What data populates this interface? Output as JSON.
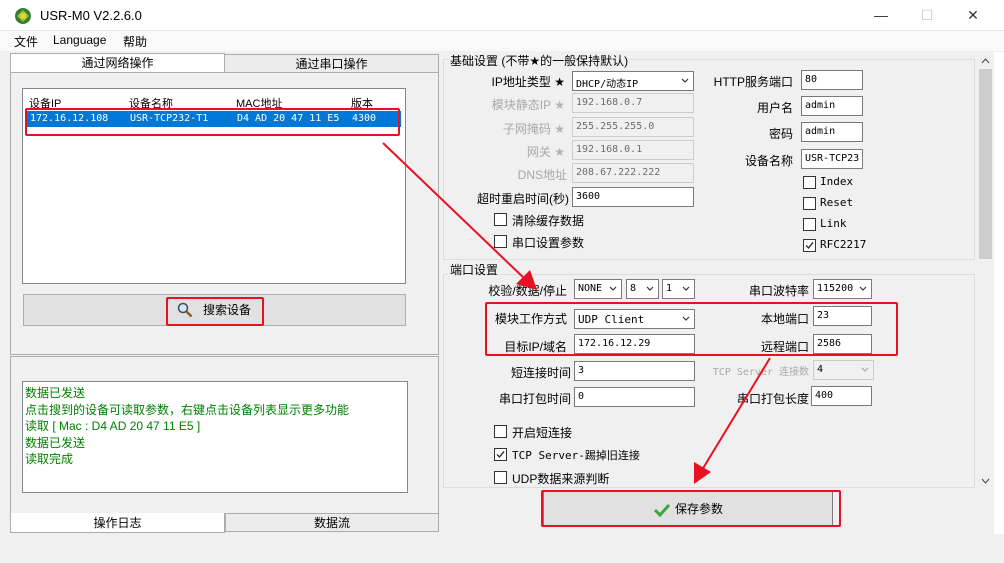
{
  "window": {
    "title": "USR-M0 V2.2.6.0",
    "minimize": "—",
    "maximize": "☐",
    "close": "✕"
  },
  "menu": [
    "文件",
    "Language",
    "帮助"
  ],
  "left_tabs": {
    "network": "通过网络操作",
    "serial": "通过串口操作"
  },
  "device_list": {
    "columns": [
      "设备IP",
      "设备名称",
      "MAC地址",
      "版本"
    ],
    "rows": [
      {
        "ip": "172.16.12.108",
        "name": "USR-TCP232-T1",
        "mac": "D4 AD 20 47 11 E5",
        "version": "4300"
      }
    ]
  },
  "search_button": "搜索设备",
  "log_lines": [
    "数据已发送",
    "点击搜到的设备可读取参数，右键点击设备列表显示更多功能",
    "读取 [ Mac : D4 AD 20 47 11 E5 ]",
    "数据已发送",
    "读取完成"
  ],
  "bottom_tabs": {
    "log": "操作日志",
    "stream": "数据流"
  },
  "basic": {
    "title": "基础设置 (不带★的一般保持默认)",
    "ip_type_label": "IP地址类型",
    "ip_type_value": "DHCP/动态IP",
    "static_ip_label": "模块静态IP",
    "static_ip_value": "192.168.0.7",
    "subnet_label": "子网掩码",
    "subnet_value": "255.255.255.0",
    "gateway_label": "网关",
    "gateway_value": "192.168.0.1",
    "dns_label": "DNS地址",
    "dns_value": "208.67.222.222",
    "timeout_label": "超时重启时间(秒)",
    "timeout_value": "3600",
    "clear_cache_label": "清除缓存数据",
    "serial_params_label": "串口设置参数",
    "http_port_label": "HTTP服务端口",
    "http_port_value": "80",
    "username_label": "用户名",
    "username_value": "admin",
    "password_label": "密码",
    "password_value": "admin",
    "devname_label": "设备名称",
    "devname_value": "USR-TCP23",
    "index_label": "Index",
    "reset_label": "Reset",
    "link_label": "Link",
    "rfc_label": "RFC2217"
  },
  "port": {
    "title": "端口设置",
    "parity_label": "校验/数据/停止",
    "parity_value": "NONE",
    "data_value": "8",
    "stop_value": "1",
    "baud_label": "串口波特率",
    "baud_value": "115200",
    "mode_label": "模块工作方式",
    "mode_value": "UDP Client",
    "local_port_label": "本地端口",
    "local_port_value": "23",
    "target_label": "目标IP/域名",
    "target_value": "172.16.12.29",
    "remote_port_label": "远程端口",
    "remote_port_value": "2586",
    "short_conn_label": "短连接时间",
    "short_conn_value": "3",
    "tcp_conn_label": "TCP Server 连接数",
    "tcp_conn_value": "4",
    "pack_time_label": "串口打包时间",
    "pack_time_value": "0",
    "pack_len_label": "串口打包长度",
    "pack_len_value": "400",
    "enable_short_label": "开启短连接",
    "kick_label": "TCP Server-踢掉旧连接",
    "udp_judge_label": "UDP数据来源判断"
  },
  "save_button": "保存参数",
  "colors": {
    "highlight": "#e81123",
    "selection": "#0078d7",
    "log_text": "#008000"
  }
}
